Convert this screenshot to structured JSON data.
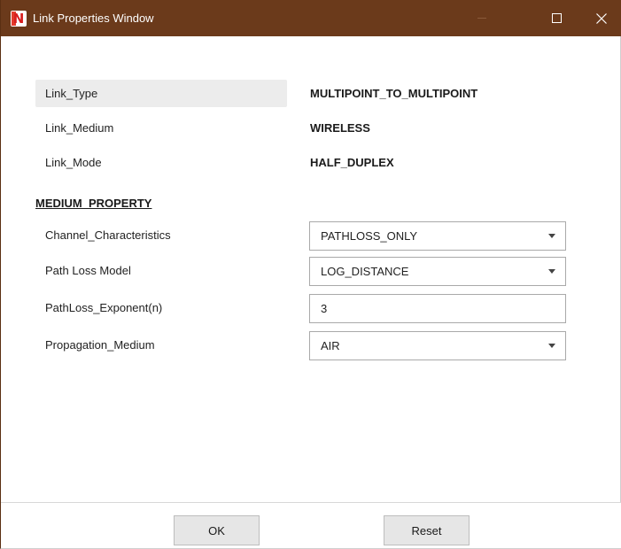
{
  "window": {
    "title": "Link Properties Window",
    "app_icon_letter": "N"
  },
  "properties": [
    {
      "label": "Link_Type",
      "value": "MULTIPOINT_TO_MULTIPOINT"
    },
    {
      "label": "Link_Medium",
      "value": "WIRELESS"
    },
    {
      "label": "Link_Mode",
      "value": "HALF_DUPLEX"
    }
  ],
  "medium_property": {
    "section_title": "MEDIUM_PROPERTY",
    "fields": [
      {
        "label": "Channel_Characteristics",
        "value": "PATHLOSS_ONLY",
        "type": "dropdown"
      },
      {
        "label": "Path Loss Model",
        "value": "LOG_DISTANCE",
        "type": "dropdown"
      },
      {
        "label": "PathLoss_Exponent(n)",
        "value": "3",
        "type": "text"
      },
      {
        "label": "Propagation_Medium",
        "value": "AIR",
        "type": "dropdown"
      }
    ]
  },
  "footer": {
    "ok_label": "OK",
    "reset_label": "Reset"
  },
  "colors": {
    "titlebar": "#6b3a1b",
    "highlight_row": "#ececec",
    "button_bg": "#e6e6e6"
  }
}
